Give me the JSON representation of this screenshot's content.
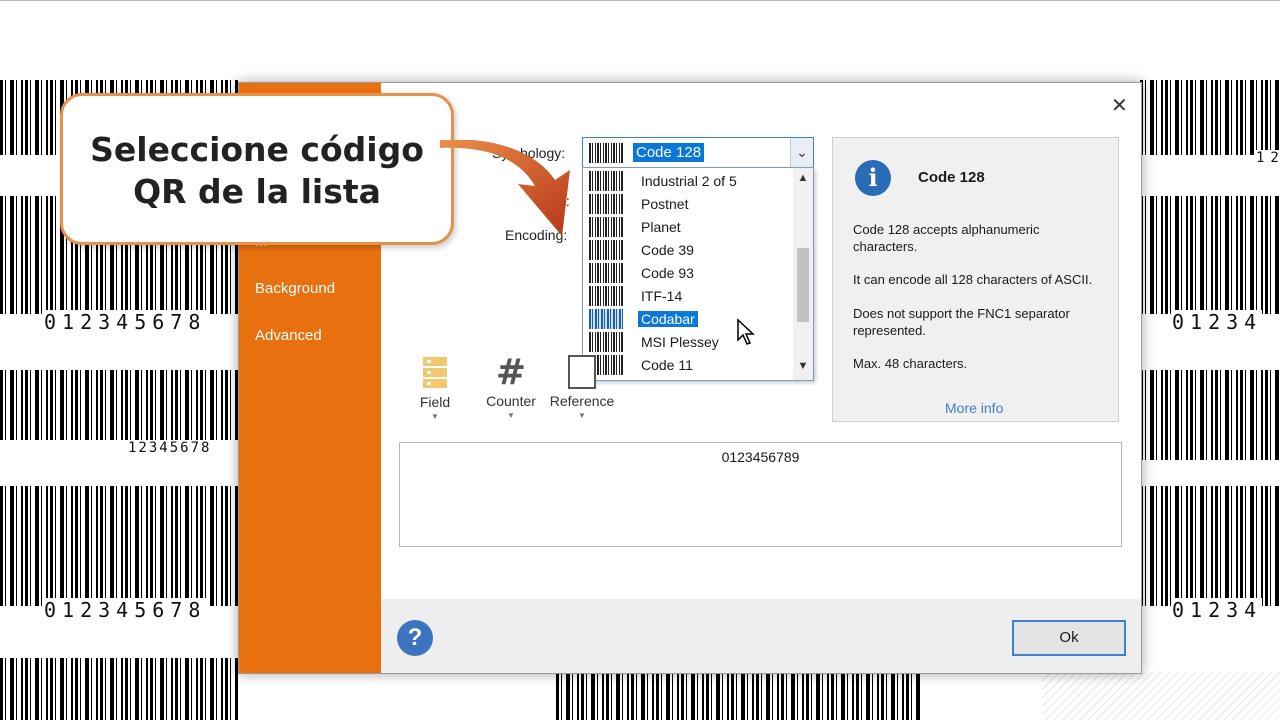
{
  "background": {
    "barcode_numbers": [
      "012345678",
      "12345678",
      "012345678",
      "12",
      "01234",
      "01234",
      "12345678"
    ]
  },
  "dialog": {
    "sidebar": {
      "partial_item": "...",
      "items": [
        "Background",
        "Advanced"
      ]
    },
    "symbology_label": "Symbology:",
    "text_label_partial": "xt:",
    "encoding_label": "Encoding:",
    "selected_symbology": "Code 128",
    "dropdown": {
      "items": [
        {
          "label": "Industrial 2 of 5",
          "selected": false
        },
        {
          "label": "Postnet",
          "selected": false
        },
        {
          "label": "Planet",
          "selected": false
        },
        {
          "label": "Code 39",
          "selected": false
        },
        {
          "label": "Code 93",
          "selected": false
        },
        {
          "label": "ITF-14",
          "selected": false
        },
        {
          "label": "Codabar",
          "selected": true
        },
        {
          "label": "MSI Plessey",
          "selected": false
        },
        {
          "label": "Code 11",
          "selected": false
        }
      ]
    },
    "info": {
      "title": "Code 128",
      "p1": "Code 128 accepts alphanumeric characters.",
      "p2": "It can encode all 128 characters of ASCII.",
      "p3": "Does not support the FNC1 separator represented.",
      "p4": "Max. 48 characters.",
      "more": "More info"
    },
    "tools": [
      {
        "label": "Field",
        "icon": "field-icon"
      },
      {
        "label": "Counter",
        "icon": "hash-icon"
      },
      {
        "label": "Reference",
        "icon": "reference-icon"
      }
    ],
    "text_value": "0123456789",
    "ok_label": "Ok",
    "help_glyph": "?",
    "close_glyph": "✕"
  },
  "callout": {
    "line1": "Seleccione código",
    "line2": "QR de la lista"
  },
  "colors": {
    "sidebar": "#e8700f",
    "selection": "#0a78d7",
    "callout_border": "#e9904a",
    "arrow": "#b8361a"
  }
}
